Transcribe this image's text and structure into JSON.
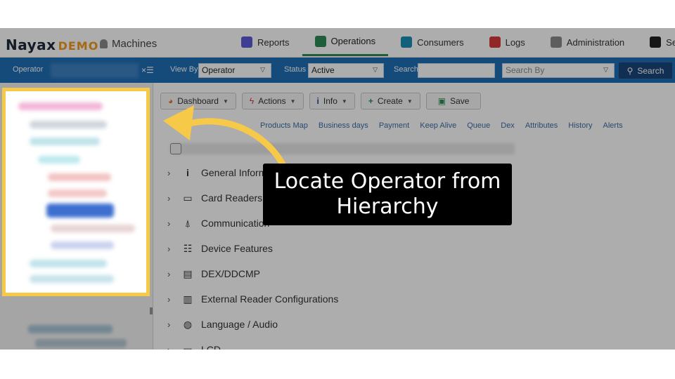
{
  "brand": {
    "name": "Nayax",
    "suffix": "DEMO",
    "page": "Machines"
  },
  "nav": {
    "tabs": [
      {
        "label": "Reports",
        "color": "#5b5bd6"
      },
      {
        "label": "Operations",
        "color": "#2e8b57"
      },
      {
        "label": "Consumers",
        "color": "#1d8fb1"
      },
      {
        "label": "Logs",
        "color": "#d63a3a"
      },
      {
        "label": "Administration",
        "color": "#6c6c6c"
      },
      {
        "label": "Settings",
        "color": "#222222"
      }
    ],
    "active": "Operations"
  },
  "filter": {
    "operator_label": "Operator",
    "view_by_label": "View By",
    "view_by_value": "Operator",
    "status_label": "Status",
    "status_value": "Active",
    "search_label": "Search",
    "search_by_placeholder": "Search By",
    "search_button": "Search"
  },
  "toolbar": {
    "dashboard": "Dashboard",
    "actions": "Actions",
    "info": "Info",
    "create": "Create",
    "save": "Save"
  },
  "subtabs": [
    "Products Map",
    "Business days",
    "Payment",
    "Keep Alive",
    "Queue",
    "Dex",
    "Attributes",
    "History",
    "Alerts"
  ],
  "sections": [
    {
      "label": "General Information",
      "icon": "info-icon"
    },
    {
      "label": "Card Readers",
      "icon": "card-reader-icon"
    },
    {
      "label": "Communication",
      "icon": "antenna-icon"
    },
    {
      "label": "Device Features",
      "icon": "features-icon"
    },
    {
      "label": "DEX/DDCMP",
      "icon": "dex-icon"
    },
    {
      "label": "External Reader Configurations",
      "icon": "reader-icon"
    },
    {
      "label": "Language / Audio",
      "icon": "globe-icon"
    },
    {
      "label": "LCD",
      "icon": "lcd-icon"
    }
  ],
  "overlay": {
    "caption": "Locate Operator from Hierarchy",
    "accent": "#f7c948"
  }
}
